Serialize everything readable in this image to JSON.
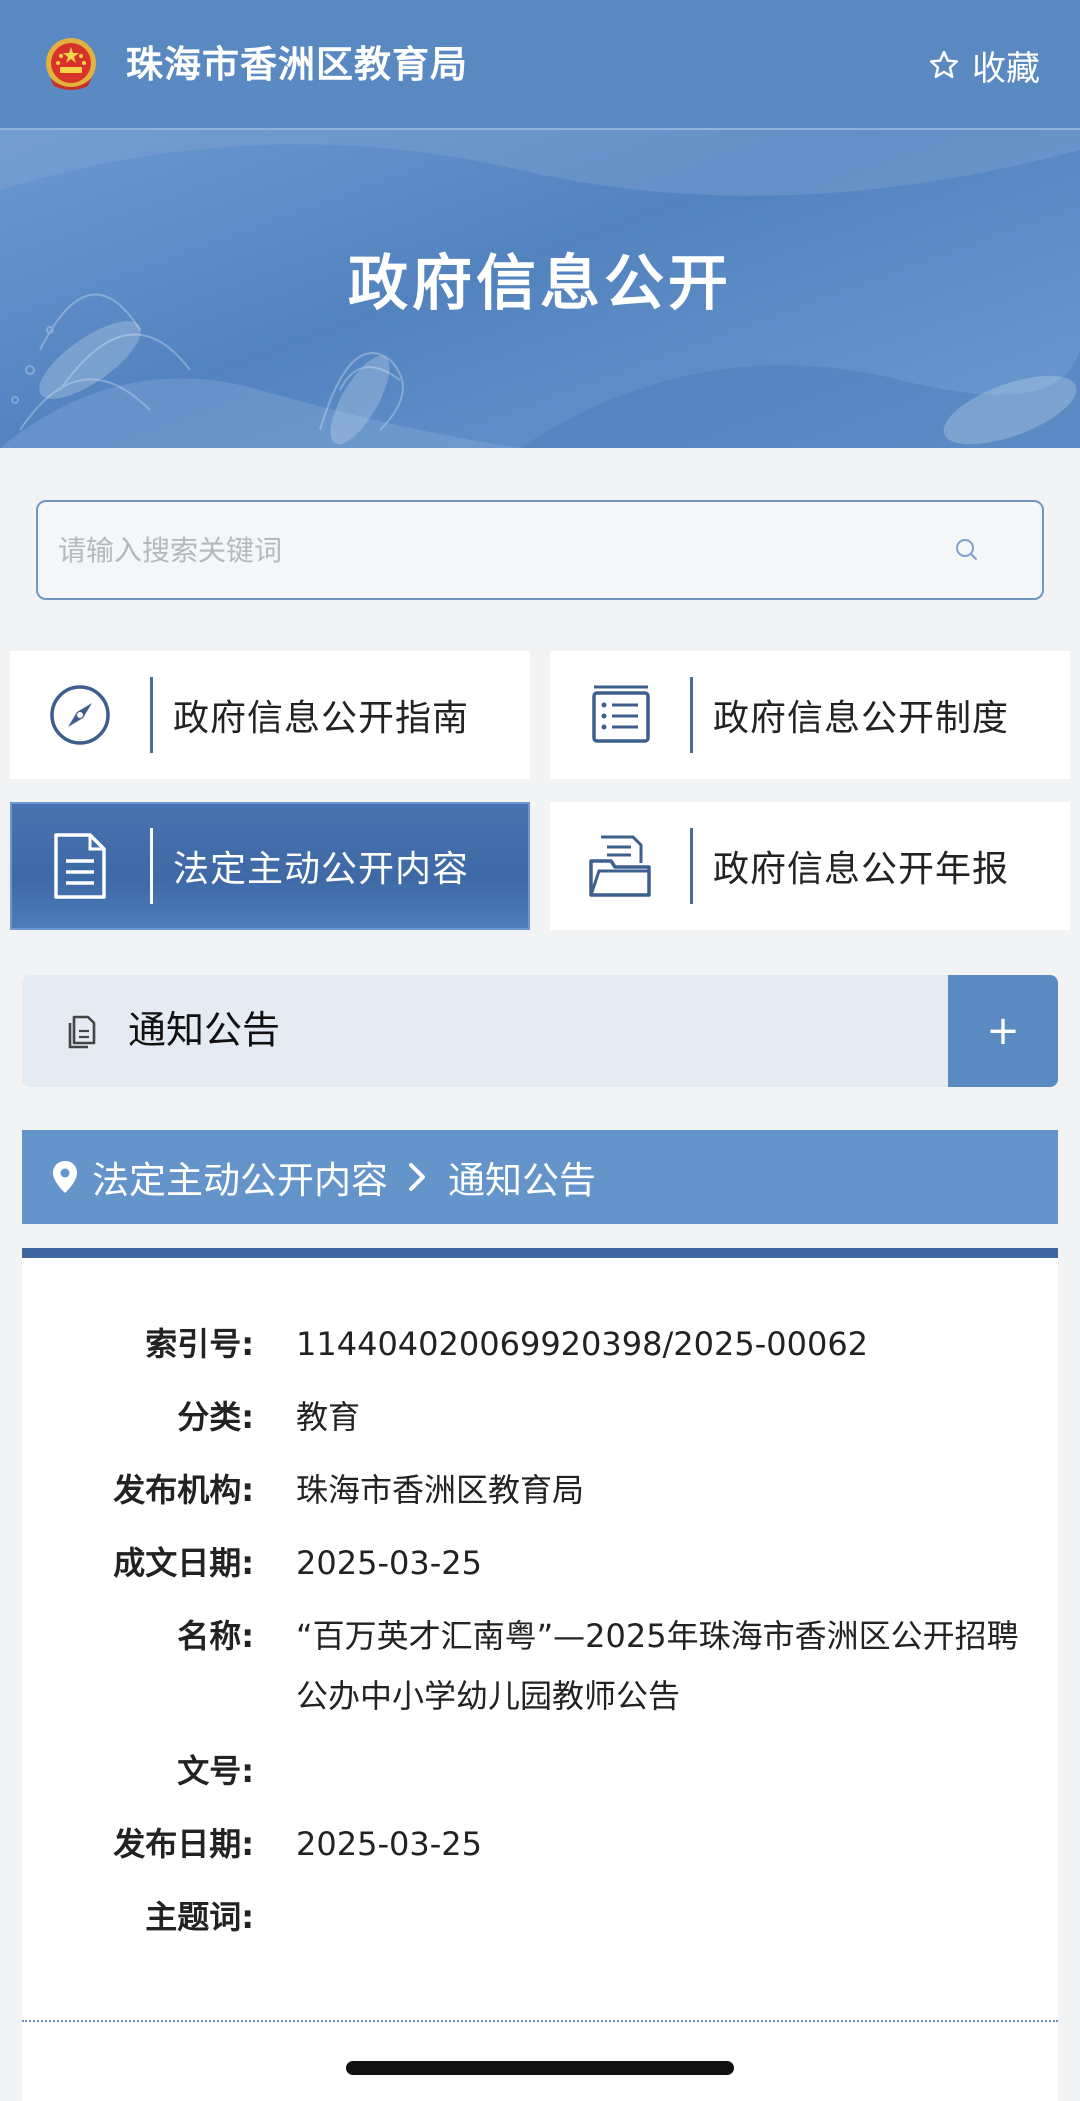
{
  "header": {
    "site_title": "珠海市香洲区教育局",
    "favorite_label": "收藏"
  },
  "banner": {
    "title": "政府信息公开"
  },
  "search": {
    "placeholder": "请输入搜索关键词"
  },
  "nav": {
    "tiles": [
      {
        "label": "政府信息公开指南",
        "icon": "compass-icon",
        "active": false
      },
      {
        "label": "政府信息公开制度",
        "icon": "list-document-icon",
        "active": false
      },
      {
        "label": "法定主动公开内容",
        "icon": "document-icon",
        "active": true
      },
      {
        "label": "政府信息公开年报",
        "icon": "folder-report-icon",
        "active": false
      }
    ]
  },
  "category": {
    "label": "通知公告",
    "expand_label": "+"
  },
  "breadcrumb": {
    "items": [
      "法定主动公开内容",
      "通知公告"
    ]
  },
  "detail": {
    "rows": [
      {
        "key": "索引号:",
        "value": "11440402006992039​8/2025-00062"
      },
      {
        "key": "分类:",
        "value": "教育"
      },
      {
        "key": "发布机构:",
        "value": "珠海市香洲区教育局"
      },
      {
        "key": "成文日期:",
        "value": "2025-03-25"
      },
      {
        "key": "名称:",
        "value": "“百万英才汇南粤”—2025年珠海市香洲区公开招聘公办中小学幼儿园教师公告"
      },
      {
        "key": "文号:",
        "value": ""
      },
      {
        "key": "发布日期:",
        "value": "2025-03-25"
      },
      {
        "key": "主题词:",
        "value": ""
      }
    ]
  },
  "colors": {
    "primary": "#5b8ac3",
    "active_tile": "#3e69a6",
    "card_border": "#3f66a0"
  }
}
